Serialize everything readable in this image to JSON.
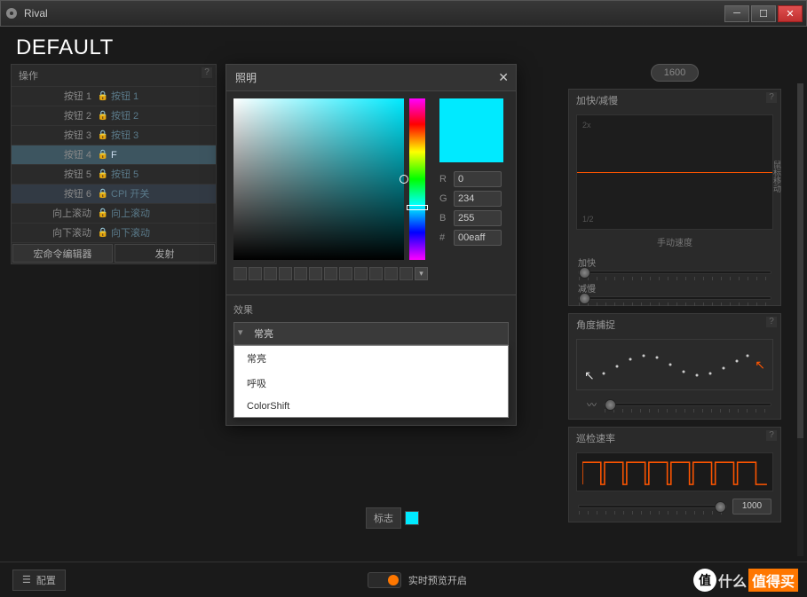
{
  "window": {
    "title": "Rival"
  },
  "header": {
    "profile": "DEFAULT"
  },
  "actions": {
    "title": "操作",
    "rows": [
      {
        "label": "按钮 1",
        "value": "按钮 1"
      },
      {
        "label": "按钮 2",
        "value": "按钮 2"
      },
      {
        "label": "按钮 3",
        "value": "按钮 3"
      },
      {
        "label": "按钮 4",
        "value": "F"
      },
      {
        "label": "按钮 5",
        "value": "按钮 5"
      },
      {
        "label": "按钮 6",
        "value": "CPI 开关"
      },
      {
        "label": "向上滚动",
        "value": "向上滚动"
      },
      {
        "label": "向下滚动",
        "value": "向下滚动"
      }
    ],
    "macro": "宏命令编辑器",
    "launch": "发射"
  },
  "lighting": {
    "title": "照明",
    "r_label": "R",
    "g_label": "G",
    "b_label": "B",
    "hex_label": "#",
    "r": "0",
    "g": "234",
    "b": "255",
    "hex": "00eaff",
    "fx_title": "效果",
    "fx_selected": "常亮",
    "fx_options": [
      "常亮",
      "呼吸",
      "ColorShift"
    ]
  },
  "logo": {
    "label": "标志"
  },
  "cpi": {
    "value": "1600"
  },
  "accel": {
    "title": "加快/减慢",
    "y2x": "2x",
    "yhalf": "1/2",
    "ylabel": "鼠标移动",
    "xlabel": "手动速度",
    "fast": "加快",
    "slow": "减慢"
  },
  "angle": {
    "title": "角度捕捉"
  },
  "polling": {
    "title": "巡检速率",
    "value": "1000"
  },
  "bottom": {
    "config": "配置",
    "preview": "实时预览开启"
  },
  "watermark": {
    "badge": "值",
    "t1": "什么",
    "t2": "值得买"
  }
}
